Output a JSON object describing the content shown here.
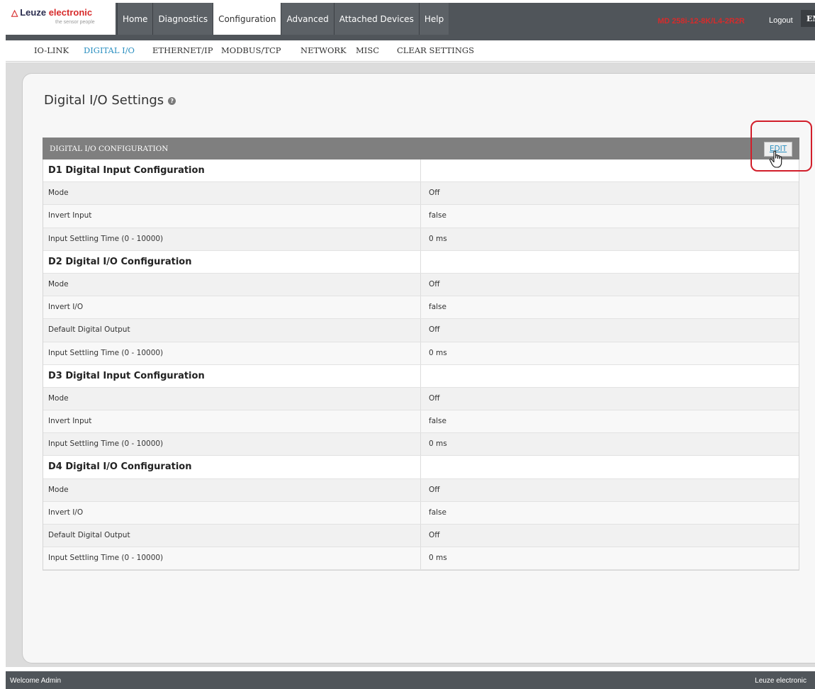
{
  "header": {
    "brand_name": "Leuze",
    "brand_accent": "electronic",
    "tagline": "the sensor people",
    "nav": [
      "Home",
      "Diagnostics",
      "Configuration",
      "Advanced",
      "Attached Devices",
      "Help"
    ],
    "active_nav": "Configuration",
    "device_id": "MD 258i-12-8K/L4-2R2R",
    "logout_label": "Logout",
    "language": "EN"
  },
  "subnav": {
    "items": [
      "IO-LINK",
      "DIGITAL I/O",
      "ETHERNET/IP",
      "MODBUS/TCP",
      "NETWORK",
      "MISC",
      "CLEAR SETTINGS"
    ],
    "active": "DIGITAL I/O"
  },
  "page": {
    "title": "Digital I/O Settings",
    "help_icon": "help-icon"
  },
  "config": {
    "section_title": "DIGITAL I/O CONFIGURATION",
    "edit_label": "EDIT",
    "rows": [
      {
        "type": "group",
        "label": "D1 Digital Input Configuration",
        "value": ""
      },
      {
        "type": "data",
        "label": "Mode",
        "value": "Off"
      },
      {
        "type": "data",
        "label": "Invert Input",
        "value": "false"
      },
      {
        "type": "data",
        "label": "Input Settling Time (0 - 10000)",
        "value": "0 ms"
      },
      {
        "type": "group",
        "label": "D2 Digital I/O Configuration",
        "value": ""
      },
      {
        "type": "data",
        "label": "Mode",
        "value": "Off"
      },
      {
        "type": "data",
        "label": "Invert I/O",
        "value": "false"
      },
      {
        "type": "data",
        "label": "Default Digital Output",
        "value": "Off"
      },
      {
        "type": "data",
        "label": "Input Settling Time (0 - 10000)",
        "value": "0 ms"
      },
      {
        "type": "group",
        "label": "D3 Digital Input Configuration",
        "value": ""
      },
      {
        "type": "data",
        "label": "Mode",
        "value": "Off"
      },
      {
        "type": "data",
        "label": "Invert Input",
        "value": "false"
      },
      {
        "type": "data",
        "label": "Input Settling Time (0 - 10000)",
        "value": "0 ms"
      },
      {
        "type": "group",
        "label": "D4 Digital I/O Configuration",
        "value": ""
      },
      {
        "type": "data",
        "label": "Mode",
        "value": "Off"
      },
      {
        "type": "data",
        "label": "Invert I/O",
        "value": "false"
      },
      {
        "type": "data",
        "label": "Default Digital Output",
        "value": "Off"
      },
      {
        "type": "data",
        "label": "Input Settling Time (0 - 10000)",
        "value": "0 ms"
      }
    ]
  },
  "footer": {
    "left": "Welcome Admin",
    "right": "Leuze electronic"
  },
  "colors": {
    "header_bg": "#50555a",
    "accent_blue": "#2a8fc0",
    "brand_red": "#d72b2b",
    "highlight_red": "#d21e2a",
    "section_bar": "#7f7f7f"
  }
}
